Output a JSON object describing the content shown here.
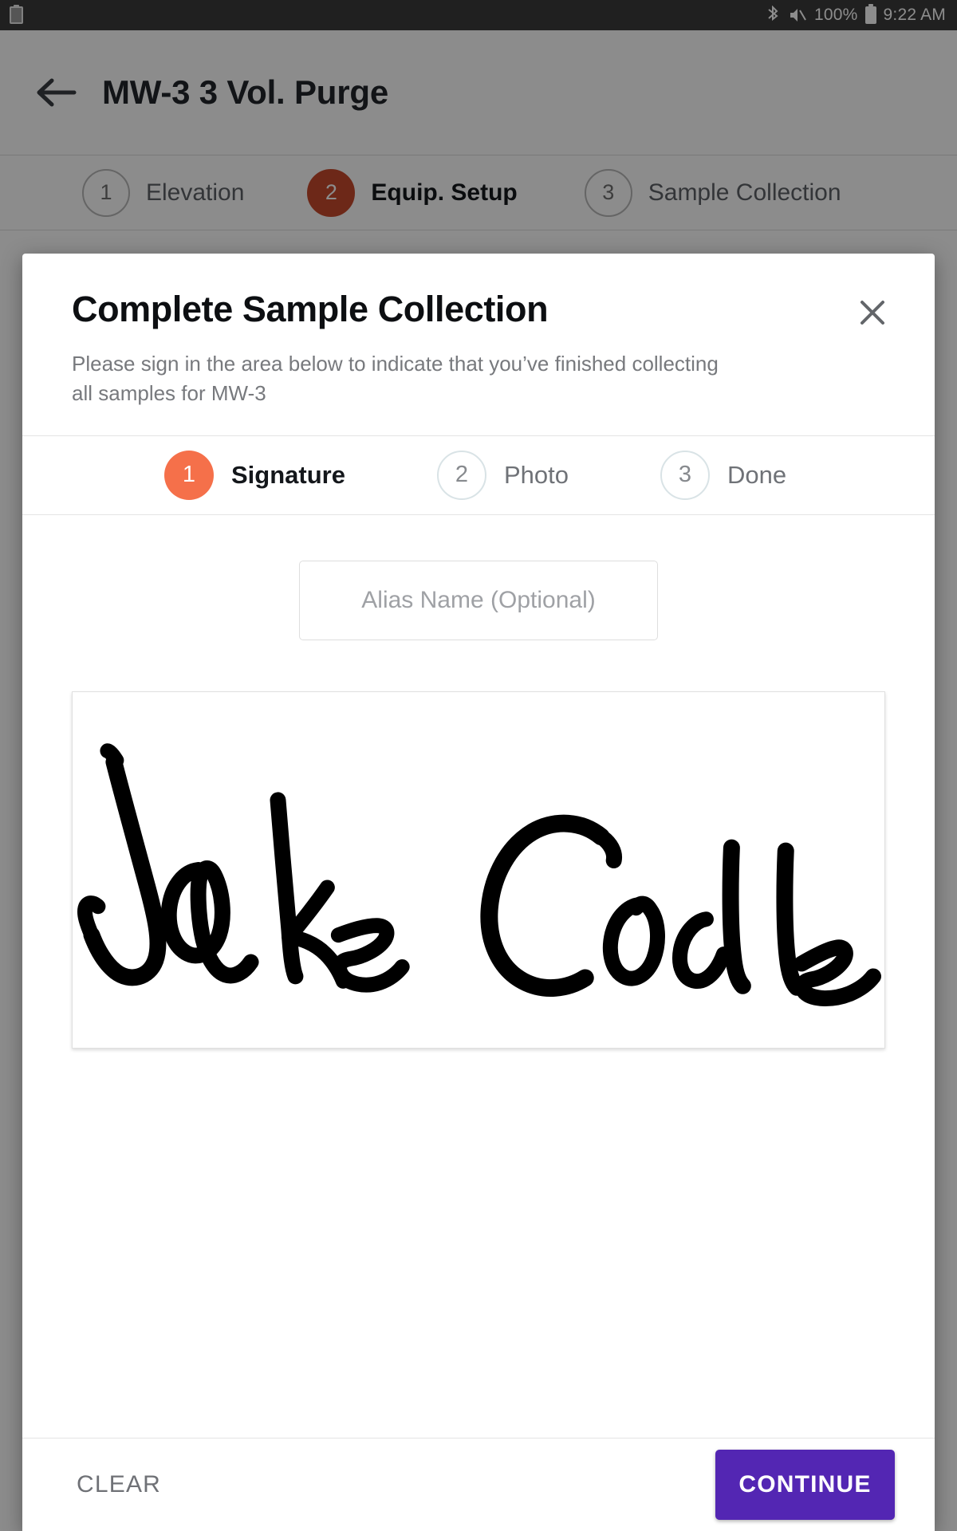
{
  "statusbar": {
    "app_icon": "clipboard-icon",
    "bluetooth_icon": "bluetooth-icon",
    "volume_muted_icon": "volume-off-icon",
    "battery_percent": "100%",
    "battery_icon": "battery-full-icon",
    "time": "9:22 AM"
  },
  "toolbar": {
    "back_icon": "arrow-left-icon",
    "title": "MW-3 3 Vol. Purge"
  },
  "background_stepper": {
    "steps": [
      {
        "number": "1",
        "label": "Elevation",
        "state": "idle"
      },
      {
        "number": "2",
        "label": "Equip. Setup",
        "state": "active"
      },
      {
        "number": "3",
        "label": "Sample Collection",
        "state": "idle"
      }
    ],
    "active_color": "#C6492C"
  },
  "dialog": {
    "title": "Complete Sample Collection",
    "subtitle": "Please sign in the area below to indicate that you’ve finished collecting all samples for MW-3",
    "close_icon": "close-icon",
    "stepper": {
      "steps": [
        {
          "number": "1",
          "label": "Signature",
          "state": "active"
        },
        {
          "number": "2",
          "label": "Photo",
          "state": "idle"
        },
        {
          "number": "3",
          "label": "Done",
          "state": "idle"
        }
      ],
      "active_color": "#F5704A"
    },
    "alias_field": {
      "placeholder": "Alias Name (Optional)",
      "value": ""
    },
    "signature_pad": {
      "signed_name": "Jake Codle",
      "ink_color": "#000000",
      "is_signed": "true"
    },
    "footer": {
      "clear_label": "CLEAR",
      "continue_label": "CONTINUE",
      "continue_color": "#5326B3"
    }
  }
}
